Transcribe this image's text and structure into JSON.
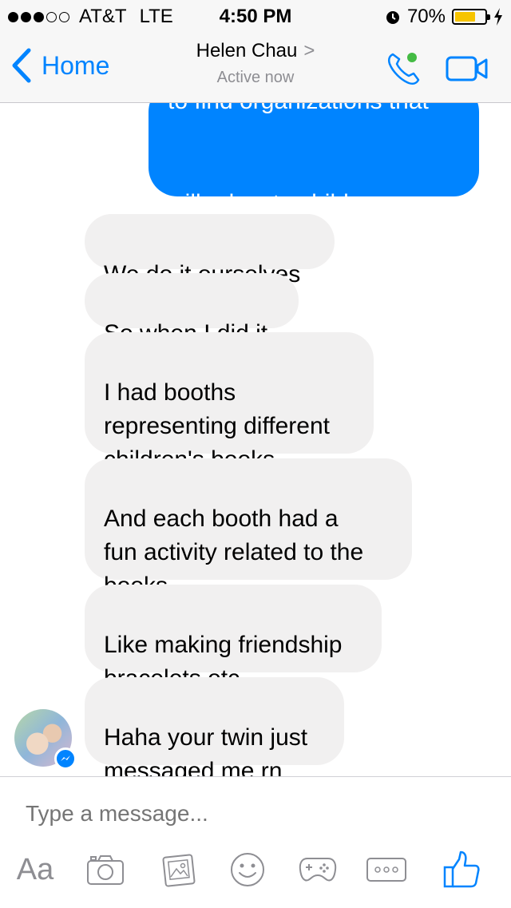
{
  "status_bar": {
    "carrier": "AT&T",
    "network": "LTE",
    "time": "4:50 PM",
    "battery": "70%",
    "battery_level": 0.7,
    "signal_bars_filled": 3,
    "signal_bars_total": 5
  },
  "header": {
    "back_label": "Home",
    "contact_name": "Helen Chau",
    "chevron": ">",
    "status": "Active now",
    "accent_color": "#0084ff",
    "presence_color": "#44bb44"
  },
  "messages": [
    {
      "direction": "out",
      "text": "will educate children or\nare doing that ourselves?"
    },
    {
      "direction": "in",
      "text": "We do it ourselves"
    },
    {
      "direction": "in",
      "text": "So when I did it"
    },
    {
      "direction": "in",
      "text": "I had booths\nrepresenting different\nchildren's books"
    },
    {
      "direction": "in",
      "text": "And each booth had a\nfun activity related to the\nbooks"
    },
    {
      "direction": "in",
      "text": "Like making friendship\nbracelets etc"
    },
    {
      "direction": "in",
      "text": "Haha your twin just\nmessaged me rn"
    }
  ],
  "partial_message_text": "to find organizations that",
  "composer": {
    "placeholder": "Type a message...",
    "aa_label": "Aa",
    "tools": [
      "text-format-icon",
      "camera-icon",
      "photo-icon",
      "sticker-icon",
      "game-icon",
      "more-icon",
      "like-icon"
    ]
  }
}
